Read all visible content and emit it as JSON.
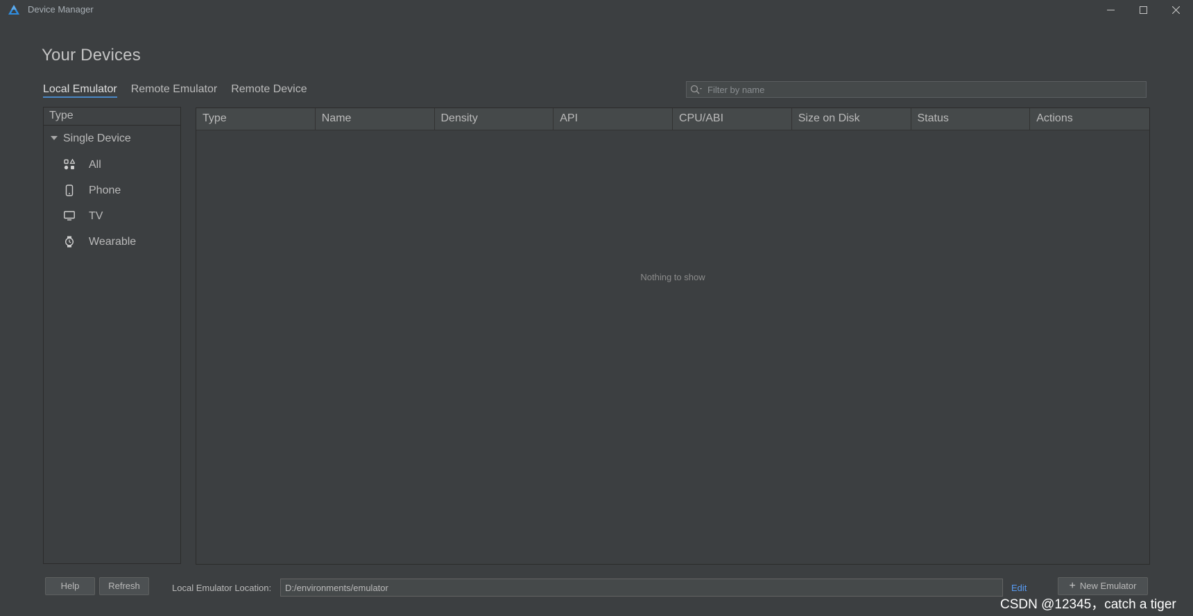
{
  "window": {
    "title": "Device Manager",
    "icons": {
      "logo": "app-logo-icon",
      "minimize": "minimize-icon",
      "maximize": "maximize-icon",
      "close": "close-icon"
    }
  },
  "page": {
    "title": "Your Devices"
  },
  "tabs": [
    {
      "label": "Local Emulator",
      "active": true
    },
    {
      "label": "Remote Emulator",
      "active": false
    },
    {
      "label": "Remote Device",
      "active": false
    }
  ],
  "filter": {
    "placeholder": "Filter by name",
    "icon": "search-icon"
  },
  "sidebar": {
    "header": "Type",
    "group": {
      "label": "Single Device",
      "expanded": true,
      "icon": "collapse-triangle-icon"
    },
    "items": [
      {
        "label": "All",
        "icon": "all-devices-icon"
      },
      {
        "label": "Phone",
        "icon": "phone-icon"
      },
      {
        "label": "TV",
        "icon": "tv-icon"
      },
      {
        "label": "Wearable",
        "icon": "watch-icon"
      }
    ]
  },
  "table": {
    "columns": [
      "Type",
      "Name",
      "Density",
      "API",
      "CPU/ABI",
      "Size on Disk",
      "Status",
      "Actions"
    ],
    "rows": [],
    "empty_text": "Nothing to show"
  },
  "footer": {
    "help_label": "Help",
    "refresh_label": "Refresh",
    "location_label": "Local Emulator Location:",
    "location_value": "D:/environments/emulator",
    "edit_label": "Edit",
    "new_emulator_label": "New Emulator",
    "new_emulator_icon": "plus-icon"
  },
  "watermark": "CSDN @12345，catch a tiger",
  "colors": {
    "background": "#3c3f41",
    "accent": "#4a88c7",
    "link": "#589df6",
    "text": "#bbbbbb"
  }
}
